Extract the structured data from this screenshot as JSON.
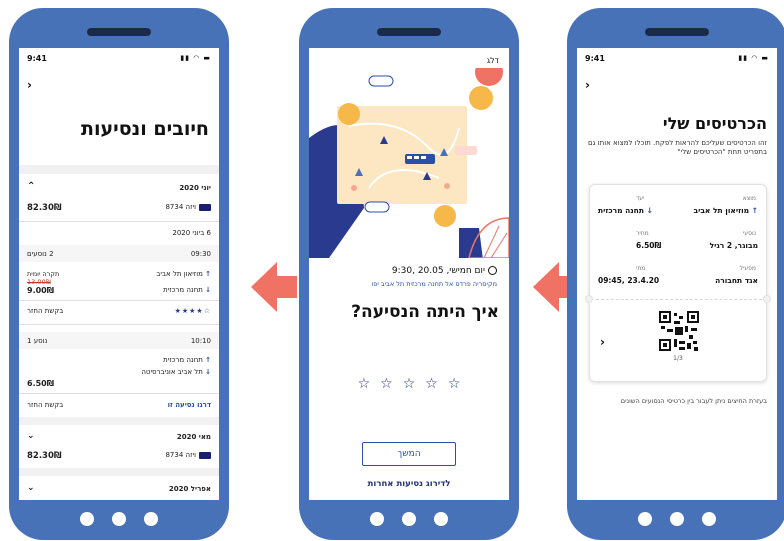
{
  "status_time": "9:41",
  "left": {
    "title": "חיובים ונסיעות",
    "june": {
      "month": "יוני 2020",
      "amount": "82.30₪",
      "card": "ויזה 8734"
    },
    "day_label": "6 ביוני 2020",
    "trip1": {
      "time": "09:30",
      "passengers": "2 נוסעים",
      "from": "מוזיאון תל אביב",
      "to": "תחנה מרכזית",
      "cap_label": "תקרה יומית",
      "old_price": "13.00₪",
      "price": "9.00₪",
      "rating": "☆★★★★",
      "refund": "בקשת החזר"
    },
    "trip2": {
      "time": "10:10",
      "passengers": "נוסע 1",
      "from": "תחנה מרכזית",
      "to": "תל אביב אוניברסיטה",
      "price": "6.50₪",
      "rate_link": "דרגו נסיעה זו",
      "refund": "בקשת החזר"
    },
    "may": {
      "month": "מאי 2020",
      "amount": "82.30₪",
      "card": "ויזה 8734"
    },
    "april": {
      "month": "אפריל 2020"
    }
  },
  "center": {
    "skip": "דלג",
    "date": "יום חמישי, 20.05 ,9:30",
    "route": "מקיסריה פרדס אל תחנה מרכזית תל אביב יפו",
    "question": "איך היתה הנסיעה?",
    "stars": [
      "☆",
      "☆",
      "☆",
      "☆",
      "☆"
    ],
    "continue": "המשך",
    "more": "לדירוג נסיעות אחרות"
  },
  "right": {
    "title": "הכרטיסים שלי",
    "subtitle": "זהו הכרטיסים שעליכם להראות לפקח. תוכלו למצוא אותו גם בתפריט תחת \"הכרטיסים שלי\"",
    "ticket": {
      "origin_label": "מוצא",
      "origin": "מוזיאון תל אביב",
      "dest_label": "יעד",
      "dest": "תחנה מרכזית",
      "passengers_label": "נוסעי",
      "passengers": "מבוגר, 2 רגיל",
      "price_label": "מחיר",
      "price": "6.50₪",
      "operator_label": "מפעיל",
      "operator": "אגד תחבורה",
      "time_label": "מתי",
      "time": "23.4.20 ,09:45",
      "page": "1/3"
    },
    "footer": "בעזרת החיצים ניתן לעבור בין כרטיסי הנסועים השונים"
  },
  "colors": {
    "frame": "#4872b8",
    "arrow": "#f07264",
    "brand": "#2a4fa8"
  }
}
